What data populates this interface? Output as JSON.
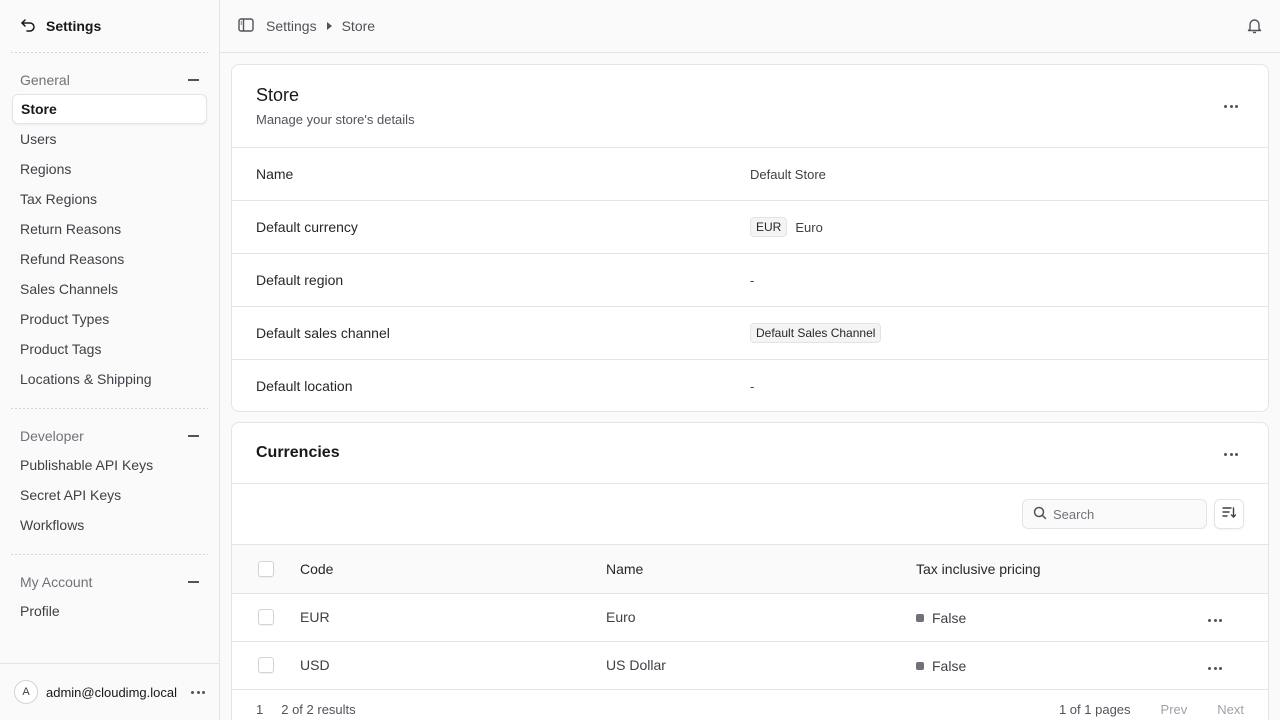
{
  "sidebar": {
    "title": "Settings",
    "groups": [
      {
        "label": "General",
        "items": [
          "Store",
          "Users",
          "Regions",
          "Tax Regions",
          "Return Reasons",
          "Refund Reasons",
          "Sales Channels",
          "Product Types",
          "Product Tags",
          "Locations & Shipping"
        ]
      },
      {
        "label": "Developer",
        "items": [
          "Publishable API Keys",
          "Secret API Keys",
          "Workflows"
        ]
      },
      {
        "label": "My Account",
        "items": [
          "Profile"
        ]
      }
    ],
    "active_item": "Store",
    "user": {
      "initial": "A",
      "email": "admin@cloudimg.local"
    }
  },
  "breadcrumb": {
    "root": "Settings",
    "current": "Store"
  },
  "store": {
    "title": "Store",
    "subtitle": "Manage your store's details",
    "rows": [
      {
        "key": "Name",
        "value": "Default Store"
      },
      {
        "key": "Default currency",
        "badge": "EUR",
        "value": "Euro"
      },
      {
        "key": "Default region",
        "value": "-"
      },
      {
        "key": "Default sales channel",
        "badge": "Default Sales Channel"
      },
      {
        "key": "Default location",
        "value": "-"
      }
    ]
  },
  "currencies": {
    "title": "Currencies",
    "search_placeholder": "Search",
    "columns": {
      "code": "Code",
      "name": "Name",
      "tax": "Tax inclusive pricing"
    },
    "rows": [
      {
        "code": "EUR",
        "name": "Euro",
        "tax": "False"
      },
      {
        "code": "USD",
        "name": "US Dollar",
        "tax": "False"
      }
    ],
    "pager": {
      "start": "1",
      "range": "2 of 2 results",
      "pages": "1 of 1 pages",
      "prev": "Prev",
      "next": "Next"
    }
  },
  "icons": {
    "back": "back-arrow-icon",
    "sidebar_toggle": "sidebar-toggle-icon",
    "bell": "bell-icon",
    "search": "search-icon",
    "sort": "sort-icon",
    "more": "more-horizontal-icon"
  },
  "colors": {
    "background": "#fafafa",
    "card": "#ffffff",
    "border": "#e4e4e7",
    "status_dot": "#71717a"
  }
}
